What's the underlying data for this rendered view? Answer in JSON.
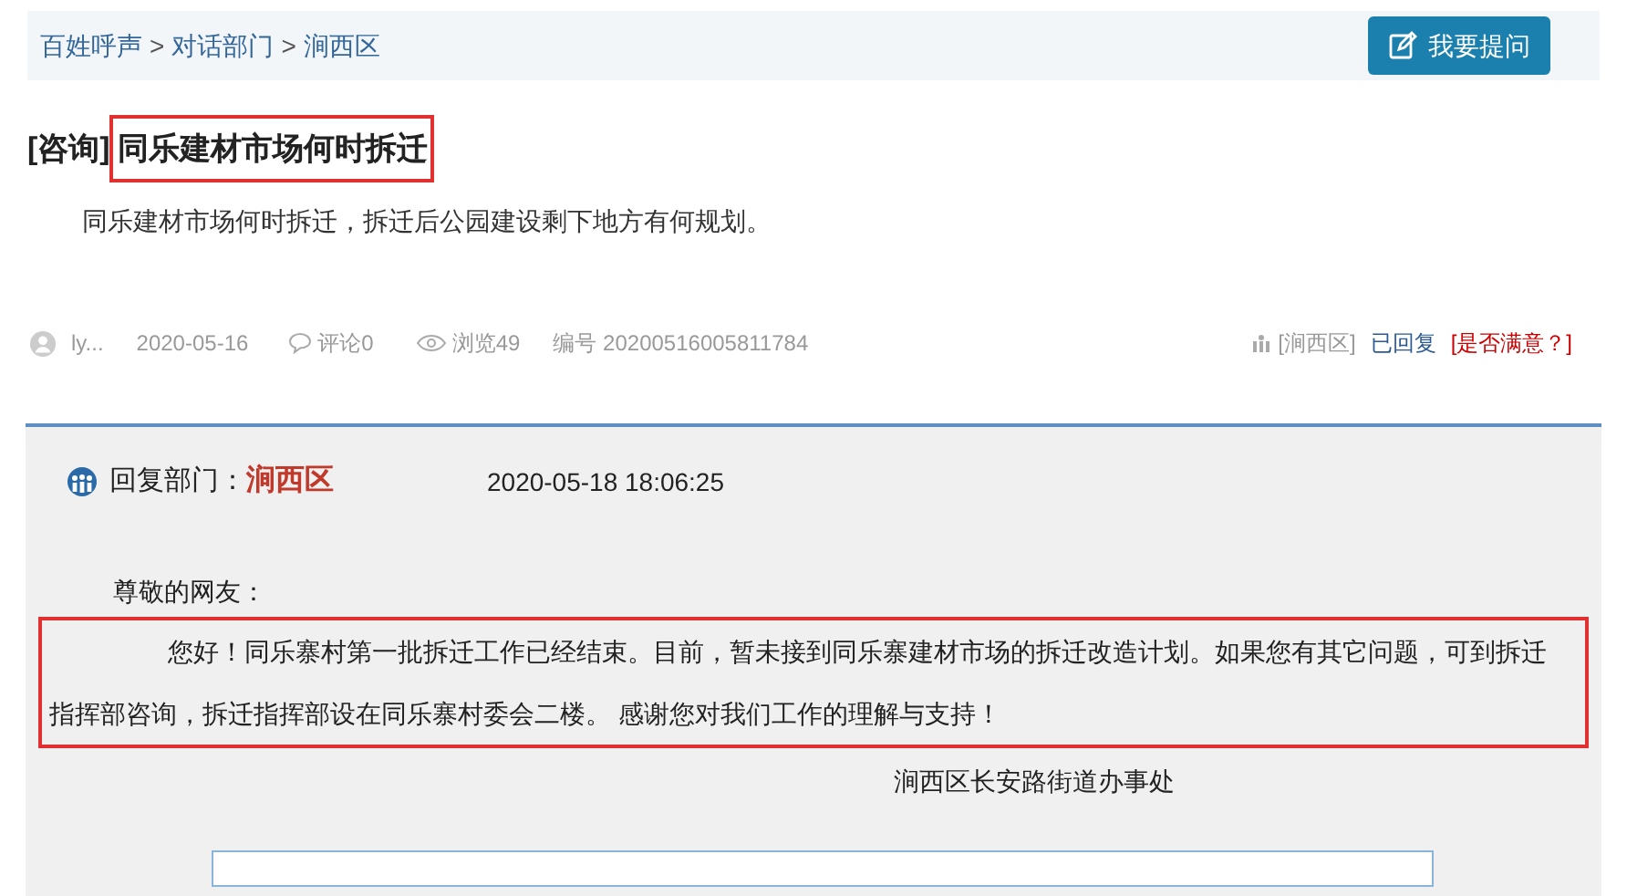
{
  "breadcrumb": [
    "百姓呼声",
    "对话部门",
    "涧西区"
  ],
  "breadcrumb_separator": ">",
  "ask_button": {
    "label": "我要提问"
  },
  "question": {
    "category": "[咨询]",
    "title": "同乐建材市场何时拆迁",
    "highlighted": true,
    "body": "同乐建材市场何时拆迁，拆迁后公园建设剩下地方有何规划。"
  },
  "meta": {
    "author": "ly...",
    "date": "2020-05-16",
    "comments": "评论0",
    "views": "浏览49",
    "number": "编号 20200516005811784",
    "department": "[涧西区]",
    "status": "已回复",
    "satisfaction": "[是否满意？]"
  },
  "reply": {
    "department_label": "回复部门：",
    "department": "涧西区",
    "time": "2020-05-18 18:06:25",
    "greeting": "尊敬的网友：",
    "body": "您好！同乐寨村第一批拆迁工作已经结束。目前，暂未接到同乐寨建材市场的拆迁改造计划。如果您有其它问题，可到拆迁指挥部咨询，拆迁指挥部设在同乐寨村委会二楼。 感谢您对我们工作的理解与支持！",
    "highlighted": true,
    "signature": "涧西区长安路街道办事处"
  }
}
